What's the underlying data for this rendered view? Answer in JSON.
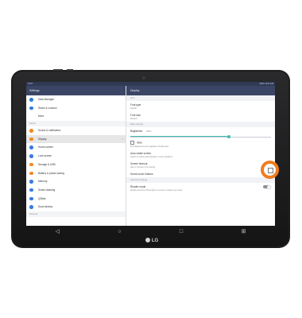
{
  "statusbar": {
    "time": "10:07",
    "right_status": "100% 10:07 AM"
  },
  "left_panel": {
    "title": "Settings",
    "items_top": [
      {
        "label": "Data Manager",
        "icon": "data-icon",
        "color": "#2f7fd6"
      },
      {
        "label": "Share & connect",
        "icon": "share-icon",
        "color": "#2f7fd6"
      },
      {
        "label": "More",
        "icon": "more-icon",
        "color": "#ffffff"
      }
    ],
    "section_device": "Device",
    "items_device": [
      {
        "label": "Sound & notification",
        "icon": "sound-icon",
        "color": "#f28a25"
      },
      {
        "label": "Display",
        "icon": "display-icon",
        "color": "#f28a25",
        "selected": true,
        "chevron": "›"
      },
      {
        "label": "Home screen",
        "icon": "home-icon",
        "color": "#3a7be0"
      },
      {
        "label": "Lock screen",
        "icon": "lock-icon",
        "color": "#3a7be0"
      },
      {
        "label": "Storage & USB",
        "icon": "storage-icon",
        "color": "#f28a25"
      },
      {
        "label": "Battery & power saving",
        "icon": "battery-icon",
        "color": "#f28a25"
      },
      {
        "label": "Memory",
        "icon": "memory-icon",
        "color": "#3a7be0"
      },
      {
        "label": "Smart cleaning",
        "icon": "cleaning-icon",
        "color": "#3a7be0"
      },
      {
        "label": "QSlide",
        "icon": "qslide-icon",
        "color": "#3a7be0"
      },
      {
        "label": "Dual window",
        "icon": "dual-window-icon",
        "color": "#3a7be0"
      }
    ],
    "section_personal": "Personal"
  },
  "right_panel": {
    "title": "Display",
    "section_font": "Font",
    "font_type": {
      "label": "Font type",
      "value": "Default"
    },
    "font_size": {
      "label": "Font size",
      "value": "Medium"
    },
    "section_basic": "Basic settings",
    "brightness": {
      "label": "Brightness",
      "value_text": "100%",
      "level": 0.7
    },
    "auto": {
      "label": "Auto",
      "note": "Set brightness level regardless of light level"
    },
    "auto_rotate": {
      "label": "Auto-rotate screen",
      "sub": "Switch to rotate automatically in some situations"
    },
    "screen_timeout": {
      "label": "Screen timeout",
      "sub": "After 2 minutes of no activity"
    },
    "home_touch": {
      "label": "Home touch buttons"
    },
    "section_advanced": "Advanced settings",
    "reader_mode": {
      "label": "Reader mode",
      "sub": "Reduce amount of blue light on screen to reduce eye strain"
    }
  },
  "navbar": {
    "back": "◁",
    "home": "○",
    "recents": "□",
    "extra": "⊞"
  },
  "brand": "LG",
  "colors": {
    "callout": "#f07c1f",
    "accent": "#3bbfb0",
    "header": "#3b4666"
  }
}
